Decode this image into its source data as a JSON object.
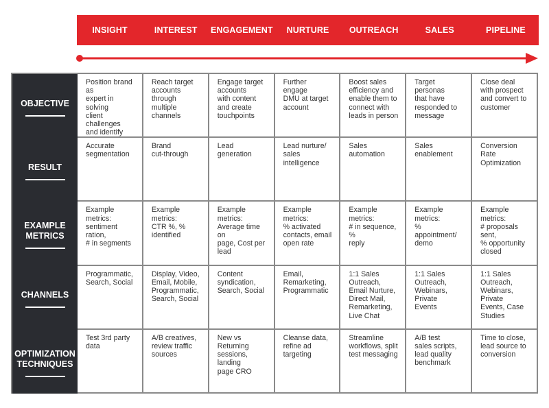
{
  "colors": {
    "accent": "#e3262b",
    "row_header_bg": "#2a2c31",
    "grid_line": "#8a8a8a"
  },
  "stages": [
    "INSIGHT",
    "INTEREST",
    "ENGAGEMENT",
    "NURTURE",
    "OUTREACH",
    "SALES",
    "PIPELINE"
  ],
  "timeline": {
    "icon": "progress-arrow-icon"
  },
  "rows": [
    {
      "label": "OBJECTIVE",
      "cells": [
        "Position brand as\nexpert in solving\nclient challenges\nand identify\ntarget accounts",
        "Reach target\naccounts through\nmultiple channels",
        "Engage target\naccounts\nwith content\nand create\ntouchpoints",
        "Further engage\nDMU at target\naccount",
        "Boost sales\nefficiency and\nenable them to\nconnect with\nleads in person",
        "Target personas\nthat have\nresponded to\nmessage",
        "Close deal\nwith prospect\nand convert to\ncustomer"
      ]
    },
    {
      "label": "RESULT",
      "cells": [
        "Accurate\nsegmentation",
        "Brand\ncut-through",
        "Lead generation",
        "Lead nurture/\nsales intelligence",
        "Sales automation",
        "Sales\nenablement",
        "Conversion Rate\nOptimization"
      ]
    },
    {
      "label": "EXAMPLE\nMETRICS",
      "cells": [
        "Example metrics:\nsentiment ration,\n# in segments",
        "Example metrics:\nCTR %, %\nidentified",
        "Example metrics:\nAverage time on\npage, Cost per\nlead",
        "Example metrics:\n% activated\ncontacts, email\nopen rate",
        "Example metrics:\n# in sequence, %\nreply",
        "Example metrics:\n% appointment/\ndemo",
        "Example metrics:\n# proposals sent,\n% opportunity\nclosed"
      ]
    },
    {
      "label": "CHANNELS",
      "cells": [
        "Programmatic,\nSearch, Social",
        "Display, Video,\nEmail, Mobile,\nProgrammatic,\nSearch, Social",
        "Content\nsyndication,\nSearch, Social",
        "Email,\nRemarketing,\nProgrammatic",
        "1:1 Sales\nOutreach,\nEmail Nurture,\nDirect Mail,\nRemarketing,\nLive Chat",
        "1:1 Sales\nOutreach,\nWebinars, Private\nEvents",
        "1:1 Sales\nOutreach,\nWebinars, Private\nEvents, Case\nStudies"
      ]
    },
    {
      "label": "OPTIMIZATION\nTECHNIQUES",
      "cells": [
        "Test 3rd party\ndata",
        "A/B creatives,\nreview traffic\nsources",
        "New vs Returning\nsessions, landing\npage CRO",
        "Cleanse data,\nrefine ad\ntargeting",
        "Streamline\nworkflows, split\ntest messaging",
        "A/B test\nsales scripts,\nlead quality\nbenchmark",
        "Time to close,\nlead source to\nconversion"
      ]
    }
  ]
}
